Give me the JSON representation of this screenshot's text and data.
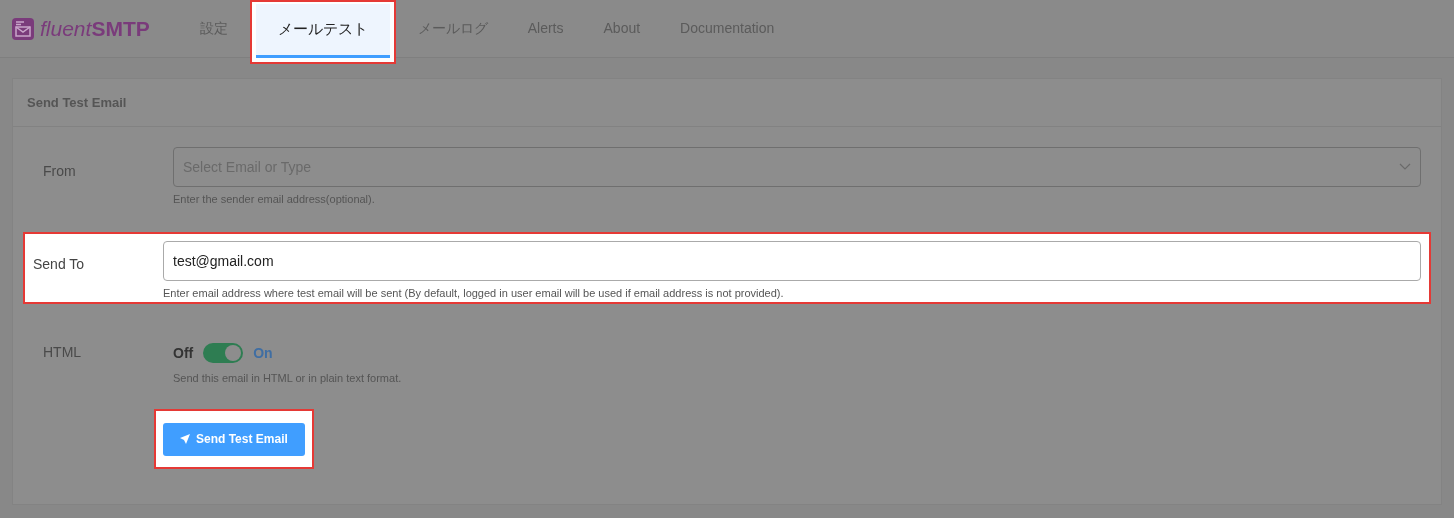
{
  "logo": {
    "light": "fluent",
    "bold": "SMTP"
  },
  "tabs": [
    {
      "label": "設定",
      "selected": false,
      "highlighted": false
    },
    {
      "label": "メールテスト",
      "selected": true,
      "highlighted": true
    },
    {
      "label": "メールログ",
      "selected": false,
      "highlighted": false
    },
    {
      "label": "Alerts",
      "selected": false,
      "highlighted": false
    },
    {
      "label": "About",
      "selected": false,
      "highlighted": false
    },
    {
      "label": "Documentation",
      "selected": false,
      "highlighted": false
    }
  ],
  "card": {
    "title": "Send Test Email",
    "fields": [
      {
        "kind": "select",
        "label": "From",
        "placeholder": "Select Email or Type",
        "help": "Enter the sender email address(optional).",
        "highlighted": false
      },
      {
        "kind": "text",
        "label": "Send To",
        "value": "test@gmail.com",
        "help": "Enter email address where test email will be sent (By default, logged in user email will be used if email address is not provided).",
        "highlighted": true
      },
      {
        "kind": "switch",
        "label": "HTML",
        "off_label": "Off",
        "on_label": "On",
        "on": true,
        "help": "Send this email in HTML or in plain text format.",
        "highlighted": false
      }
    ],
    "button": {
      "label": "Send Test Email",
      "highlighted": true
    }
  }
}
